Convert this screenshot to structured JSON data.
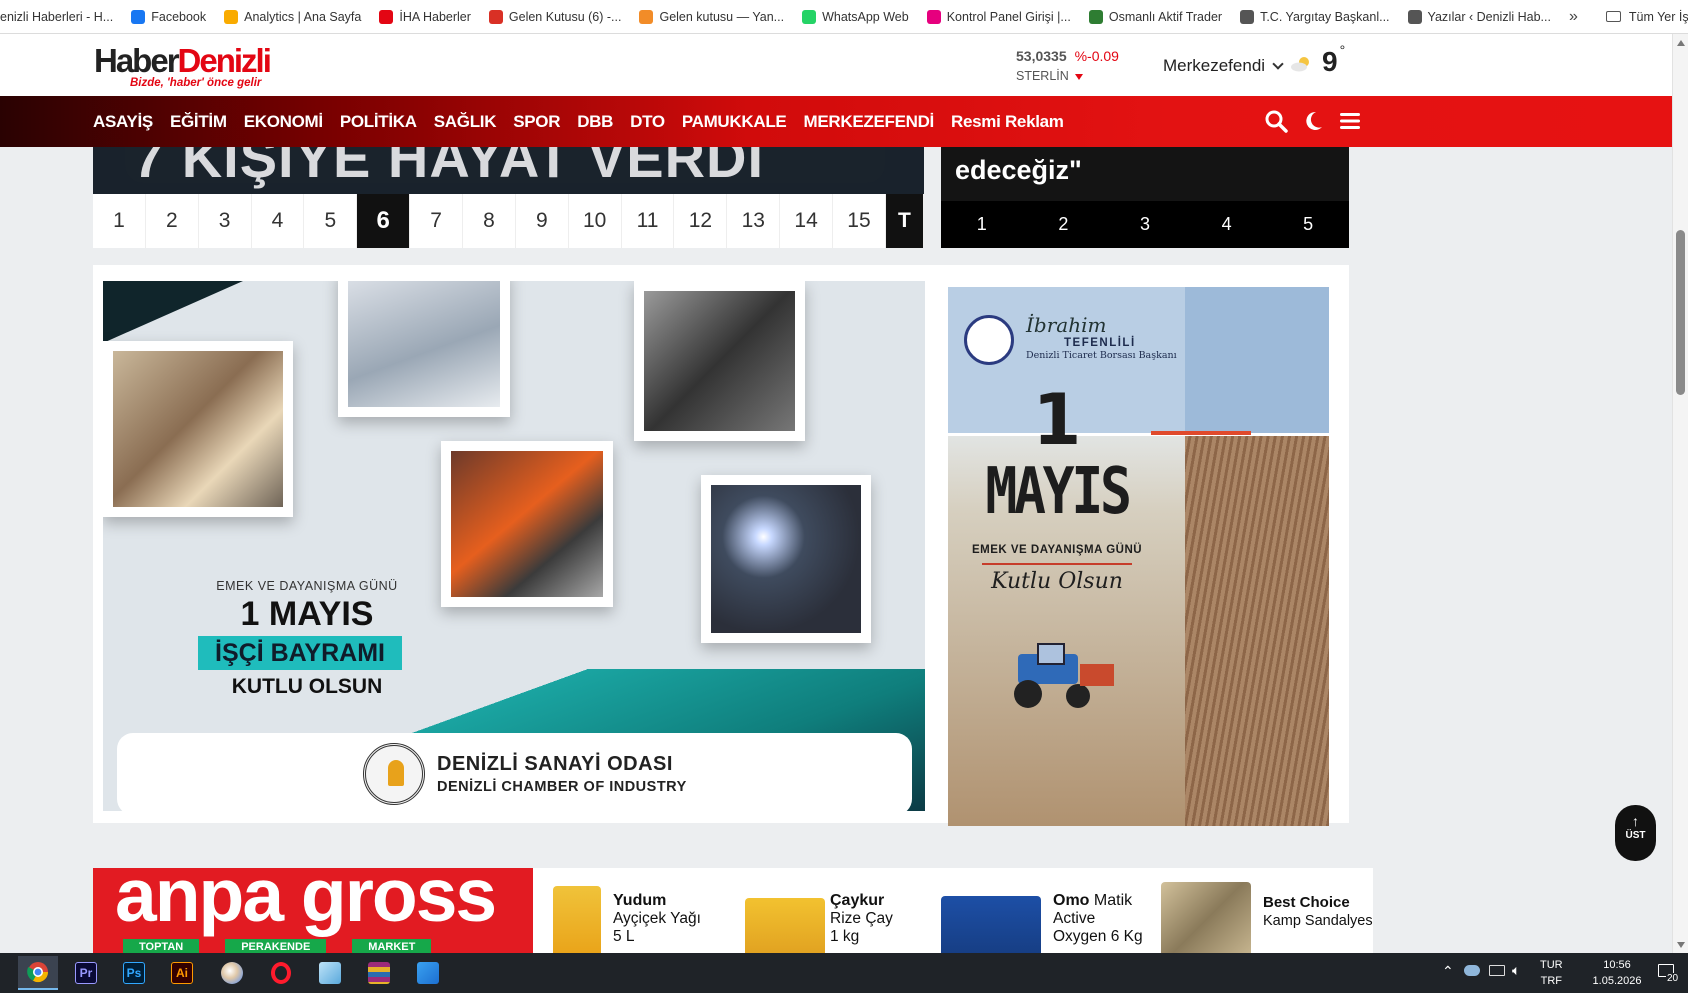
{
  "bookmarks": {
    "items": [
      {
        "label": "enizli Haberleri - H...",
        "icon": "news-icon",
        "color": "#b0b0b0"
      },
      {
        "label": "Facebook",
        "icon": "facebook-icon",
        "color": "#1877f2"
      },
      {
        "label": "Analytics | Ana Sayfa",
        "icon": "analytics-icon",
        "color": "#f9ab00"
      },
      {
        "label": "İHA Haberler",
        "icon": "iha-icon",
        "color": "#e30613"
      },
      {
        "label": "Gelen Kutusu (6) -...",
        "icon": "gmail-icon",
        "color": "#d93025"
      },
      {
        "label": "Gelen kutusu — Yan...",
        "icon": "mail-icon",
        "color": "#f28c28"
      },
      {
        "label": "WhatsApp Web",
        "icon": "whatsapp-icon",
        "color": "#25d366"
      },
      {
        "label": "Kontrol Panel Girişi |...",
        "icon": "te-icon",
        "color": "#e6007e"
      },
      {
        "label": "Osmanlı Aktif Trader",
        "icon": "trader-icon",
        "color": "#2e7d32"
      },
      {
        "label": "T.C. Yargıtay Başkanl...",
        "icon": "globe-icon",
        "color": "#555555"
      },
      {
        "label": "Yazılar ‹ Denizli Hab...",
        "icon": "wordpress-icon",
        "color": "#555555"
      }
    ],
    "more": "»",
    "folder_label": "Tüm Yer İşaretleri"
  },
  "header": {
    "logo_haber": "Haber",
    "logo_denizli": "Denizli",
    "logo_tagline": "Bizde, 'haber' önce gelir",
    "fx_value": "53,0335",
    "fx_change": "%-0.09",
    "fx_currency": "STERLİN",
    "city": "Merkezefendi",
    "temperature": "9",
    "temperature_unit": "°"
  },
  "nav": {
    "items": [
      "ASAYİŞ",
      "EĞİTİM",
      "EKONOMİ",
      "POLİTİKA",
      "SAĞLIK",
      "SPOR",
      "DBB",
      "DTO",
      "PAMUKKALE",
      "MERKEZEFENDİ",
      "Resmi Reklam"
    ]
  },
  "slider_main": {
    "caption": "7 KİŞİYE HAYAT VERDİ",
    "pages": [
      "1",
      "2",
      "3",
      "4",
      "5",
      "6",
      "7",
      "8",
      "9",
      "10",
      "11",
      "12",
      "13",
      "14",
      "15"
    ],
    "active_page": "6",
    "last_label": "T"
  },
  "slider_side": {
    "caption": "edeceğiz\"",
    "pages": [
      "1",
      "2",
      "3",
      "4",
      "5"
    ]
  },
  "ad_dso": {
    "line1": "EMEK VE DAYANIŞMA GÜNÜ",
    "line2": "1 MAYIS",
    "line3": "İŞÇİ BAYRAMI",
    "line4": "KUTLU OLSUN",
    "org_name": "DENİZLİ SANAYİ ODASI",
    "org_name_en": "DENİZLİ CHAMBER OF INDUSTRY"
  },
  "ad_dtb": {
    "signature": "İbrahim",
    "surname": "TEFENLİLİ",
    "title": "Denizli Ticaret Borsası Başkanı",
    "big_number": "1",
    "big_month": "MAYIS",
    "subtitle": "EMEK VE DAYANIŞMA GÜNÜ",
    "greeting": "Kutlu Olsun"
  },
  "ad_anpa": {
    "brand": "anpa gross",
    "tags": [
      "TOPTAN",
      "PERAKENDE",
      "MARKET"
    ],
    "products": [
      {
        "brand": "Yudum",
        "desc": "Ayçiçek Yağı",
        "size": "5 L"
      },
      {
        "brand": "Çaykur",
        "desc": "Rize Çay",
        "size": "1 kg"
      },
      {
        "brand": "Omo",
        "brand_rest": "Matik",
        "desc": "Active",
        "size": "Oxygen 6 Kg"
      },
      {
        "brand": "Best Choice",
        "desc": "Kamp Sandalyesi",
        "size": ""
      }
    ]
  },
  "ust_button": {
    "label": "ÜST",
    "arrow": "↑"
  },
  "taskbar": {
    "apps": [
      "chrome-icon",
      "premiere-icon",
      "photoshop-icon",
      "illustrator-icon",
      "paint-icon",
      "opera-icon",
      "notepad-icon",
      "winrar-icon",
      "photos-icon"
    ],
    "lang1": "TUR",
    "lang2": "TRF",
    "time": "10:56",
    "date": "1.05.2026",
    "notifications": "20"
  },
  "colors": {
    "brand_red": "#e30613",
    "nav_dark": "#2a0202",
    "teal": "#1fbcbc"
  }
}
